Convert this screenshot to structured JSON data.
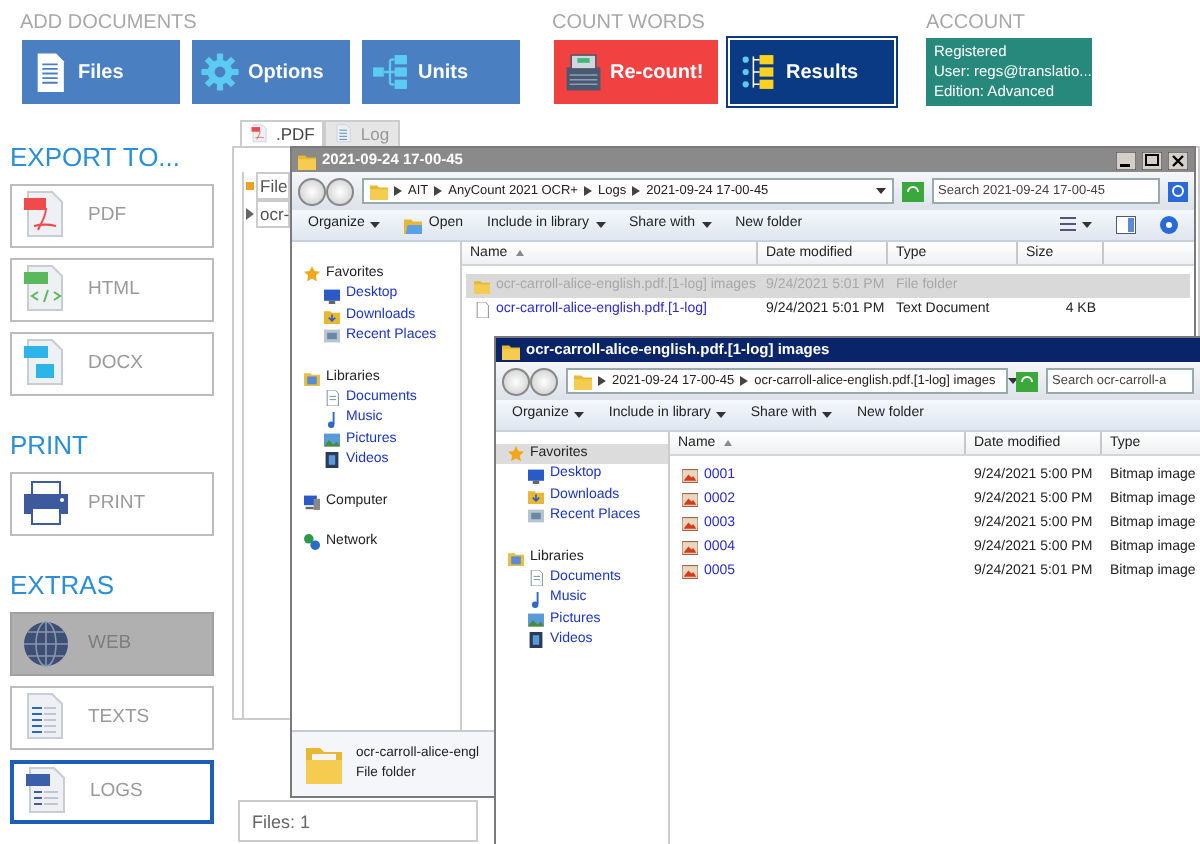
{
  "header": {
    "groups": [
      {
        "title": "ADD DOCUMENTS",
        "buttons": [
          {
            "label": "Files",
            "color": "#4a80c2",
            "selected": false
          },
          {
            "label": "Options",
            "color": "#4a80c2",
            "selected": false
          },
          {
            "label": "Units",
            "color": "#4a80c2",
            "selected": false
          }
        ]
      },
      {
        "title": "COUNT WORDS",
        "buttons": [
          {
            "label": "Re-count!",
            "color": "#f24141",
            "selected": false
          },
          {
            "label": "Results",
            "color": "#0b3a84",
            "selected": true
          }
        ]
      },
      {
        "title": "ACCOUNT",
        "account": {
          "color": "#26897c",
          "lines": [
            "Registered",
            "User: regs@translatio...",
            "Edition: Advanced"
          ]
        }
      }
    ]
  },
  "sidebar": [
    {
      "title": "EXPORT TO...",
      "items": [
        {
          "label": "PDF",
          "disabled": false,
          "selected": false
        },
        {
          "label": "HTML",
          "disabled": false,
          "selected": false
        },
        {
          "label": "DOCX",
          "disabled": false,
          "selected": false
        }
      ]
    },
    {
      "title": "PRINT",
      "items": [
        {
          "label": "PRINT",
          "disabled": false,
          "selected": false
        }
      ]
    },
    {
      "title": "EXTRAS",
      "items": [
        {
          "label": "WEB",
          "disabled": true,
          "selected": false
        },
        {
          "label": "TEXTS",
          "disabled": false,
          "selected": false
        },
        {
          "label": "LOGS",
          "disabled": false,
          "selected": true
        }
      ]
    }
  ],
  "tabs": [
    {
      "label": ".PDF",
      "selected": true
    },
    {
      "label": "Log",
      "selected": false
    }
  ],
  "grid": {
    "columns": [
      "File"
    ],
    "rows": [
      [
        "ocr-"
      ]
    ]
  },
  "status_bar": "Files: 1",
  "windows": [
    {
      "title": "2021-09-24 17-00-45",
      "active": false,
      "window_controls": true,
      "breadcrumb": [
        "AIT",
        "AnyCount 2021 OCR+",
        "Logs",
        "2021-09-24 17-00-45"
      ],
      "search": {
        "placeholder": "Search 2021-09-24 17-00-45"
      },
      "toolbar": [
        {
          "label": "Organize",
          "kind": "text",
          "menu": true
        },
        {
          "label": "Open",
          "kind": "icon",
          "menu": false
        },
        {
          "label": "Include in library",
          "kind": "text",
          "menu": true
        },
        {
          "label": "Share with",
          "kind": "text",
          "menu": true
        },
        {
          "label": "New folder",
          "kind": "text",
          "menu": false
        }
      ],
      "view_tools": true,
      "nav": [
        {
          "label": "Favorites",
          "selected": false,
          "children": [
            {
              "label": "Desktop",
              "selected": false
            },
            {
              "label": "Downloads",
              "selected": false
            },
            {
              "label": "Recent Places",
              "selected": false
            }
          ]
        },
        {
          "label": "Libraries",
          "selected": false,
          "children": [
            {
              "label": "Documents",
              "selected": false
            },
            {
              "label": "Music",
              "selected": false
            },
            {
              "label": "Pictures",
              "selected": false
            },
            {
              "label": "Videos",
              "selected": false
            }
          ]
        },
        {
          "label": "Computer",
          "selected": false
        },
        {
          "label": "Network",
          "selected": false
        }
      ],
      "columns": [
        "Name",
        "Date modified",
        "Type",
        "Size"
      ],
      "rows": [
        {
          "kind": "folder",
          "selected": true,
          "cells": [
            "ocr-carroll-alice-english.pdf.[1-log] images",
            "9/24/2021 5:01 PM",
            "File folder"
          ]
        },
        {
          "kind": "text",
          "selected": false,
          "cells": [
            "ocr-carroll-alice-english.pdf.[1-log]",
            "9/24/2021 5:01 PM",
            "Text Document",
            "4 KB"
          ]
        }
      ],
      "details": {
        "name": "ocr-carroll-alice-engl",
        "type": "File folder"
      }
    },
    {
      "title": "ocr-carroll-alice-english.pdf.[1-log] images",
      "active": true,
      "window_controls": false,
      "breadcrumb": [
        "2021-09-24 17-00-45",
        "ocr-carroll-alice-english.pdf.[1-log] images"
      ],
      "search": {
        "placeholder": "Search ocr-carroll-a"
      },
      "toolbar": [
        {
          "label": "Organize",
          "kind": "text",
          "menu": true
        },
        {
          "label": "Include in library",
          "kind": "text",
          "menu": true
        },
        {
          "label": "Share with",
          "kind": "text",
          "menu": true
        },
        {
          "label": "New folder",
          "kind": "text",
          "menu": false
        }
      ],
      "view_tools": false,
      "nav": [
        {
          "label": "Favorites",
          "selected": true,
          "children": [
            {
              "label": "Desktop",
              "selected": false
            },
            {
              "label": "Downloads",
              "selected": false
            },
            {
              "label": "Recent Places",
              "selected": false
            }
          ]
        },
        {
          "label": "Libraries",
          "selected": false,
          "children": [
            {
              "label": "Documents",
              "selected": false
            },
            {
              "label": "Music",
              "selected": false
            },
            {
              "label": "Pictures",
              "selected": false
            },
            {
              "label": "Videos",
              "selected": false
            }
          ]
        }
      ],
      "columns": [
        "Name",
        "Date modified",
        "Type"
      ],
      "rows": [
        {
          "kind": "bitmap",
          "selected": false,
          "cells": [
            "0001",
            "9/24/2021 5:00 PM",
            "Bitmap image"
          ]
        },
        {
          "kind": "bitmap",
          "selected": false,
          "cells": [
            "0002",
            "9/24/2021 5:00 PM",
            "Bitmap image"
          ]
        },
        {
          "kind": "bitmap",
          "selected": false,
          "cells": [
            "0003",
            "9/24/2021 5:00 PM",
            "Bitmap image"
          ]
        },
        {
          "kind": "bitmap",
          "selected": false,
          "cells": [
            "0004",
            "9/24/2021 5:00 PM",
            "Bitmap image"
          ]
        },
        {
          "kind": "bitmap",
          "selected": false,
          "cells": [
            "0005",
            "9/24/2021 5:01 PM",
            "Bitmap image"
          ]
        }
      ]
    }
  ]
}
